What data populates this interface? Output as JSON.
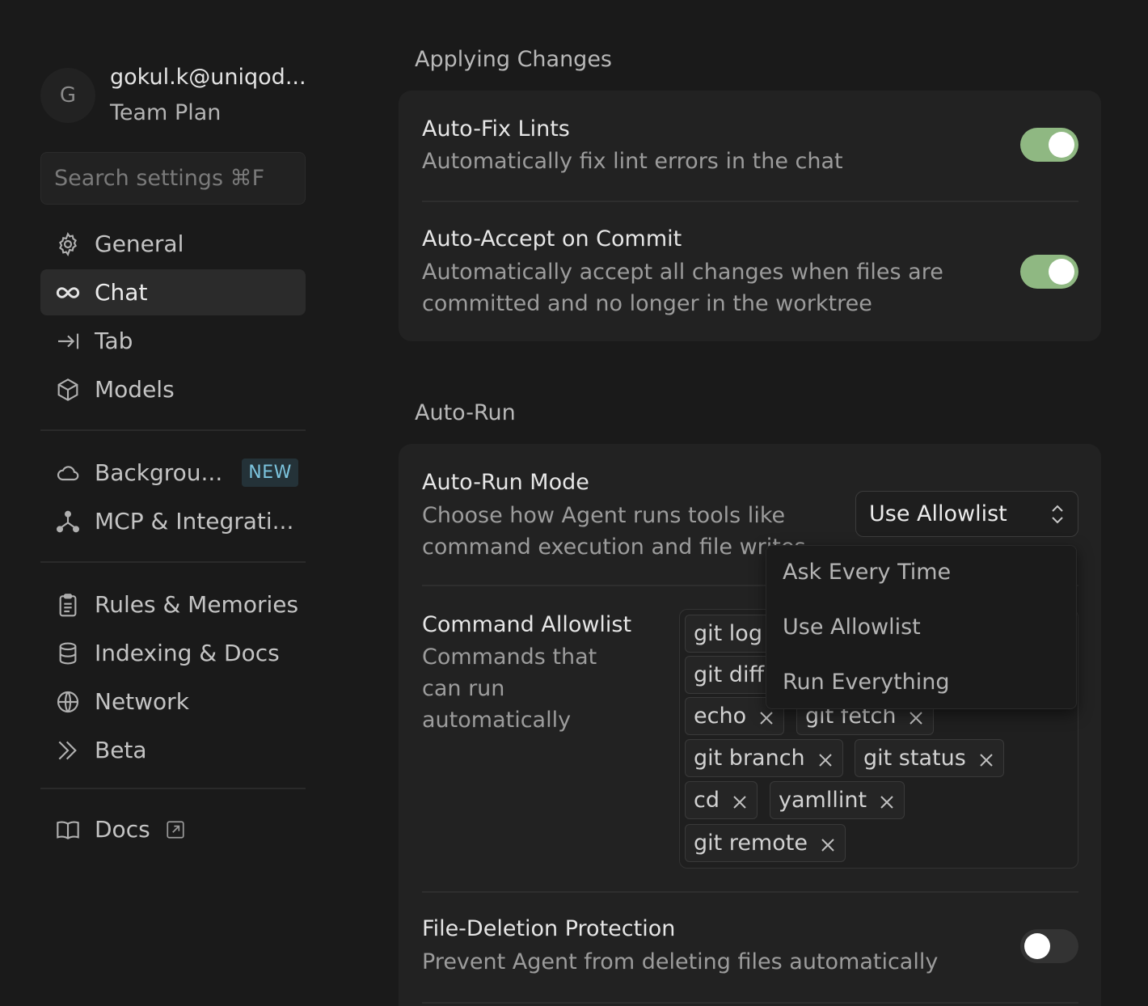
{
  "profile": {
    "avatar_initial": "G",
    "email": "gokul.k@uniqod...",
    "plan": "Team Plan"
  },
  "search": {
    "placeholder": "Search settings ⌘F"
  },
  "sidebar": {
    "items": [
      {
        "label": "General",
        "icon": "gear-icon"
      },
      {
        "label": "Chat",
        "icon": "infinity-icon",
        "active": true
      },
      {
        "label": "Tab",
        "icon": "arrow-right-to-bar-icon"
      },
      {
        "label": "Models",
        "icon": "cube-icon"
      },
      {
        "label": "Backgrou...",
        "icon": "cloud-icon",
        "badge": "NEW"
      },
      {
        "label": "MCP & Integrati...",
        "icon": "nodes-icon"
      },
      {
        "label": "Rules & Memories",
        "icon": "clipboard-icon"
      },
      {
        "label": "Indexing & Docs",
        "icon": "database-icon"
      },
      {
        "label": "Network",
        "icon": "globe-icon"
      },
      {
        "label": "Beta",
        "icon": "double-chevron-icon"
      },
      {
        "label": "Docs",
        "icon": "book-icon"
      }
    ]
  },
  "applying_changes": {
    "title": "Applying Changes",
    "auto_fix_lints": {
      "title": "Auto-Fix Lints",
      "desc": "Automatically fix lint errors in the chat",
      "enabled": true
    },
    "auto_accept": {
      "title": "Auto-Accept on Commit",
      "desc": "Automatically accept all changes when files are committed and no longer in the worktree",
      "enabled": true
    }
  },
  "auto_run": {
    "title": "Auto-Run",
    "mode": {
      "title": "Auto-Run Mode",
      "desc": "Choose how Agent runs tools like command execution and file writes",
      "selected": "Use Allowlist"
    },
    "allowlist": {
      "title": "Command Allowlist",
      "desc": "Commands that can run automatically",
      "tags": [
        "git log",
        "git diff",
        "echo",
        "git fetch",
        "git branch",
        "git status",
        "cd",
        "yamllint",
        "git remote"
      ]
    },
    "file_deletion": {
      "title": "File-Deletion Protection",
      "desc": "Prevent Agent from deleting files automatically",
      "enabled": false
    }
  },
  "dropdown": {
    "options": [
      "Ask Every Time",
      "Use Allowlist",
      "Run Everything"
    ]
  },
  "colors": {
    "toggle_on": "#8fb882",
    "badge_text": "#7cc4de"
  }
}
